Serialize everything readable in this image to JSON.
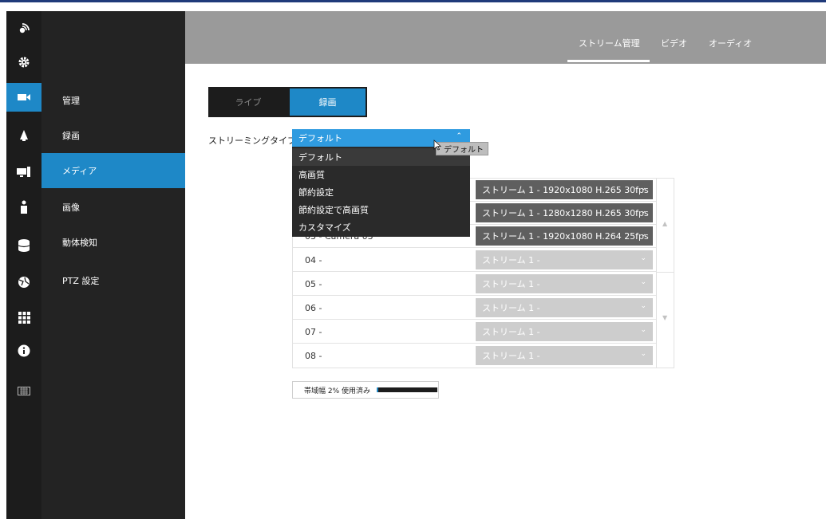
{
  "colors": {
    "accent": "#1e88c7",
    "dropdown_header": "#2f9be0",
    "rail_bg": "#1c1c1c",
    "submenu_bg": "#232323",
    "topbar_bg": "#9a9a9a"
  },
  "rail": {
    "items": [
      {
        "icon": "logo-icon",
        "active": false
      },
      {
        "icon": "gear-icon",
        "active": false
      },
      {
        "icon": "video-camera-icon",
        "active": true
      },
      {
        "icon": "bell-icon",
        "active": false
      },
      {
        "icon": "computer-icon",
        "active": false
      },
      {
        "icon": "person-icon",
        "active": false
      },
      {
        "icon": "database-icon",
        "active": false
      },
      {
        "icon": "globe-icon",
        "active": false
      },
      {
        "icon": "grid-icon",
        "active": false
      },
      {
        "icon": "info-icon",
        "active": false
      },
      {
        "icon": "keyboard-icon",
        "active": false
      }
    ]
  },
  "submenu": {
    "items": [
      {
        "label": "管理",
        "active": false
      },
      {
        "label": "録画",
        "active": false
      },
      {
        "label": "メディア",
        "active": true
      },
      {
        "label": "画像",
        "active": false
      },
      {
        "label": "動体検知",
        "active": false
      },
      {
        "label": "PTZ 設定",
        "active": false
      }
    ]
  },
  "top_tabs": {
    "stream": "ストリーム管理",
    "video": "ビデオ",
    "audio": "オーディオ",
    "active": "stream"
  },
  "mode_toggle": {
    "live": "ライブ",
    "recording": "録画",
    "active": "recording"
  },
  "streaming_type": {
    "label": "ストリーミングタイプ",
    "selected": "デフォルト",
    "options": [
      "デフォルト",
      "高画質",
      "節約設定",
      "節約設定で高画質",
      "カスタマイズ"
    ]
  },
  "tooltip": "デフォルト",
  "cameras": [
    {
      "name": "",
      "stream": "ストリーム 1 - 1920x1080 H.265 30fps",
      "enabled": true
    },
    {
      "name": "",
      "stream": "ストリーム 1 - 1280x1280 H.265 30fps",
      "enabled": true
    },
    {
      "name": "03 - Camera 03",
      "stream": "ストリーム 1 - 1920x1080 H.264 25fps",
      "enabled": true
    },
    {
      "name": "04 -",
      "stream": "ストリーム 1 -",
      "enabled": false
    },
    {
      "name": "05 -",
      "stream": "ストリーム 1 -",
      "enabled": false
    },
    {
      "name": "06 -",
      "stream": "ストリーム 1 -",
      "enabled": false
    },
    {
      "name": "07 -",
      "stream": "ストリーム 1 -",
      "enabled": false
    },
    {
      "name": "08 -",
      "stream": "ストリーム 1 -",
      "enabled": false
    }
  ],
  "bandwidth": {
    "label": "帯域幅 2% 使用済み",
    "percent": 2
  }
}
